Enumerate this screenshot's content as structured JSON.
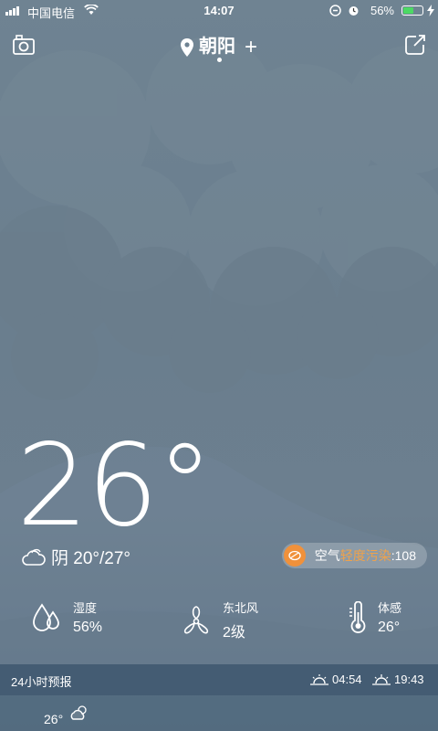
{
  "status_bar": {
    "carrier": "中国电信",
    "time": "14:07",
    "battery_percent": "56%",
    "battery_level": 0.56,
    "battery_color": "#4cd964"
  },
  "header": {
    "camera_icon": "camera-icon",
    "city": "朝阳",
    "add": "+",
    "share_icon": "share-icon"
  },
  "current": {
    "temperature": "26°",
    "condition_text": "阴 20°/27°",
    "aqi_label": "空气",
    "aqi_level": "轻度污染",
    "aqi_value": ":108",
    "aqi_color": "#f0913b"
  },
  "details": [
    {
      "icon": "humidity-icon",
      "label": "湿度",
      "value": "56%"
    },
    {
      "icon": "wind-icon",
      "label": "东北风",
      "value": "2级"
    },
    {
      "icon": "thermometer-icon",
      "label": "体感",
      "value": "26°"
    }
  ],
  "forecast": {
    "title": "24小时预报",
    "sunrise": "04:54",
    "sunset": "19:43",
    "first_hour_temp": "26°"
  }
}
